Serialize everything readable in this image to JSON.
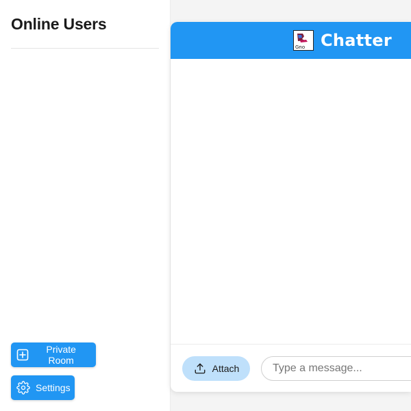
{
  "sidebar": {
    "title": "Online Users",
    "users": [],
    "buttons": {
      "private_room": {
        "label": "Private Room",
        "icon": "plus-square-icon"
      },
      "settings": {
        "label": "Settings",
        "icon": "gear-icon"
      }
    }
  },
  "chat": {
    "brand": "Chatter",
    "logo_icon": "logo-image",
    "messages": [],
    "composer": {
      "attach_label": "Attach",
      "attach_icon": "upload-icon",
      "input_placeholder": "Type a message...",
      "input_value": ""
    }
  },
  "colors": {
    "primary": "#2196f3",
    "attach_bg": "#bfe0fb",
    "page_bg": "#f4f4f4"
  }
}
